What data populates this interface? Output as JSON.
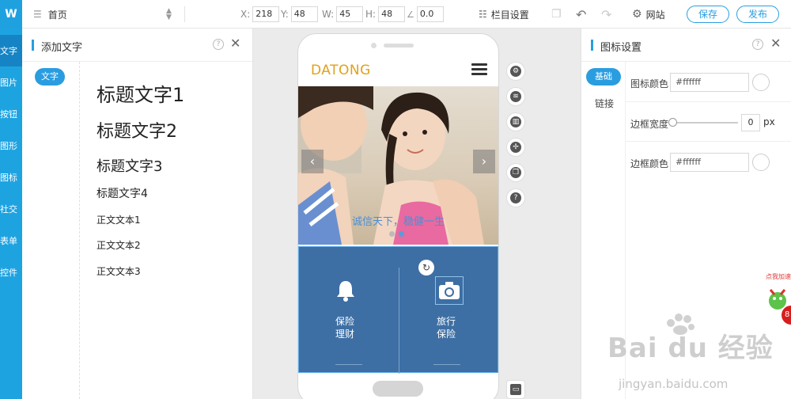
{
  "toolbar": {
    "logo": "W",
    "page_select": "首页",
    "x_label": "X:",
    "x_value": "218",
    "y_label": "Y:",
    "y_value": "48",
    "w_label": "W:",
    "w_value": "45",
    "h_label": "H:",
    "h_value": "48",
    "angle_value": "0.0",
    "columns_label": "栏目设置",
    "site_label": "网站",
    "save_label": "保存",
    "publish_label": "发布"
  },
  "rail": {
    "items": [
      "文字",
      "图片",
      "按钮",
      "图形",
      "图标",
      "社交",
      "表单",
      "控件"
    ]
  },
  "left_panel": {
    "title": "添加文字",
    "tag": "文字",
    "items": [
      "标题文字1",
      "标题文字2",
      "标题文字3",
      "标题文字4",
      "正文文本1",
      "正文文本2",
      "正文文本3"
    ]
  },
  "phone": {
    "brand": "DATONG",
    "caption": "诚信天下，稳健一生",
    "tile_left_line1": "保险",
    "tile_left_line2": "理财",
    "tile_right_line1": "旅行",
    "tile_right_line2": "保险"
  },
  "right_panel": {
    "title": "图标设置",
    "tab_basic": "基础",
    "tab_link": "链接",
    "icon_color_label": "图标颜色",
    "icon_color_value": "#ffffff",
    "border_width_label": "边框宽度",
    "border_width_value": "0",
    "border_width_unit": "px",
    "border_color_label": "边框颜色",
    "border_color_value": "#ffffff"
  },
  "watermark": {
    "brand": "Bai du 经验",
    "url": "jingyan.baidu.com",
    "promo_text": "点我加速",
    "promo_badge": "8"
  },
  "colors": {
    "accent": "#2a9de0",
    "rail": "#1ea3e1",
    "tile_bg": "#3d6fa4",
    "brand_gold": "#e0a21b"
  }
}
